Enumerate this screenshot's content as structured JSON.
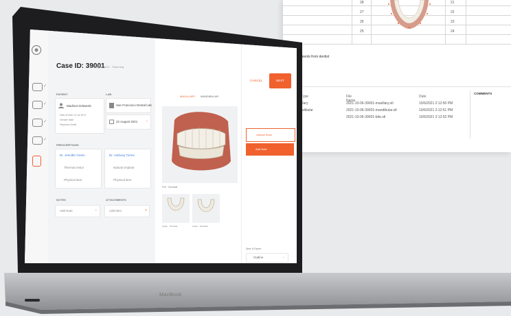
{
  "background_document": {
    "grid_numbers": [
      "28",
      "27",
      "26",
      "25",
      "21",
      "22",
      "23",
      "24"
    ],
    "note": "...ments from dentist",
    "table": {
      "headers": [
        "...Type",
        "File Name",
        "Date"
      ],
      "rows": [
        {
          "type": "...illary",
          "file": "2021-10-06-39001-maxillary.stl",
          "date": "10/6/2021 2:12:50 PM"
        },
        {
          "type": "...ndibular",
          "file": "2021-10-06-39001-mandibular.stl",
          "date": "10/6/2021 2:12:51 PM"
        },
        {
          "type": "",
          "file": "2021-10-06-39001-bite.stl",
          "date": "10/6/2021 2:12:52 PM"
        }
      ],
      "comments_header": "COMMENTS"
    }
  },
  "app": {
    "title": "Case ID: 39001",
    "subtitle": "13 August 2021 · Scanning",
    "sections": {
      "patient": "PATIENT",
      "lab": "LAB",
      "prescriptions": "PRESCRIPTIONS",
      "notes": "NOTES",
      "attachments": "ATTACHMENTS"
    },
    "patient_name": "Madison Edwards",
    "patient_details": [
      "Date of birth  13 Jul 1974",
      "Gender  Male",
      "Payment  Credit"
    ],
    "lab_name": "San Francisco Dental Lab",
    "lab_date": "22 August 2021",
    "prescriptions": [
      {
        "doctor": "Dr. Jennifer Green",
        "item1": "Thermal restor",
        "item2": "Physical item"
      },
      {
        "doctor": "Dr. Anthony Torres",
        "item1": "Natural Implant",
        "item2": "Physical item"
      }
    ],
    "notes_value": "Add Note",
    "attachments_value": "Add Item",
    "tabs": {
      "active": "MAXILLARY",
      "inactive": "MANDIBULAR"
    },
    "preview_caption": "Full · Occlusal",
    "thumb_captions": [
      "Upper · Occlusal",
      "Lower · Occlusal"
    ],
    "buttons": {
      "cancel": "CANCEL",
      "next": "NEXT"
    },
    "files": [
      {
        "label": "Upload Scan",
        "selected": false
      },
      {
        "label": "Add Note",
        "selected": true
      }
    ],
    "export": {
      "label": "Spec & Export",
      "value": "Outline"
    },
    "brand": "MacBook",
    "accent": "#f0612e"
  }
}
